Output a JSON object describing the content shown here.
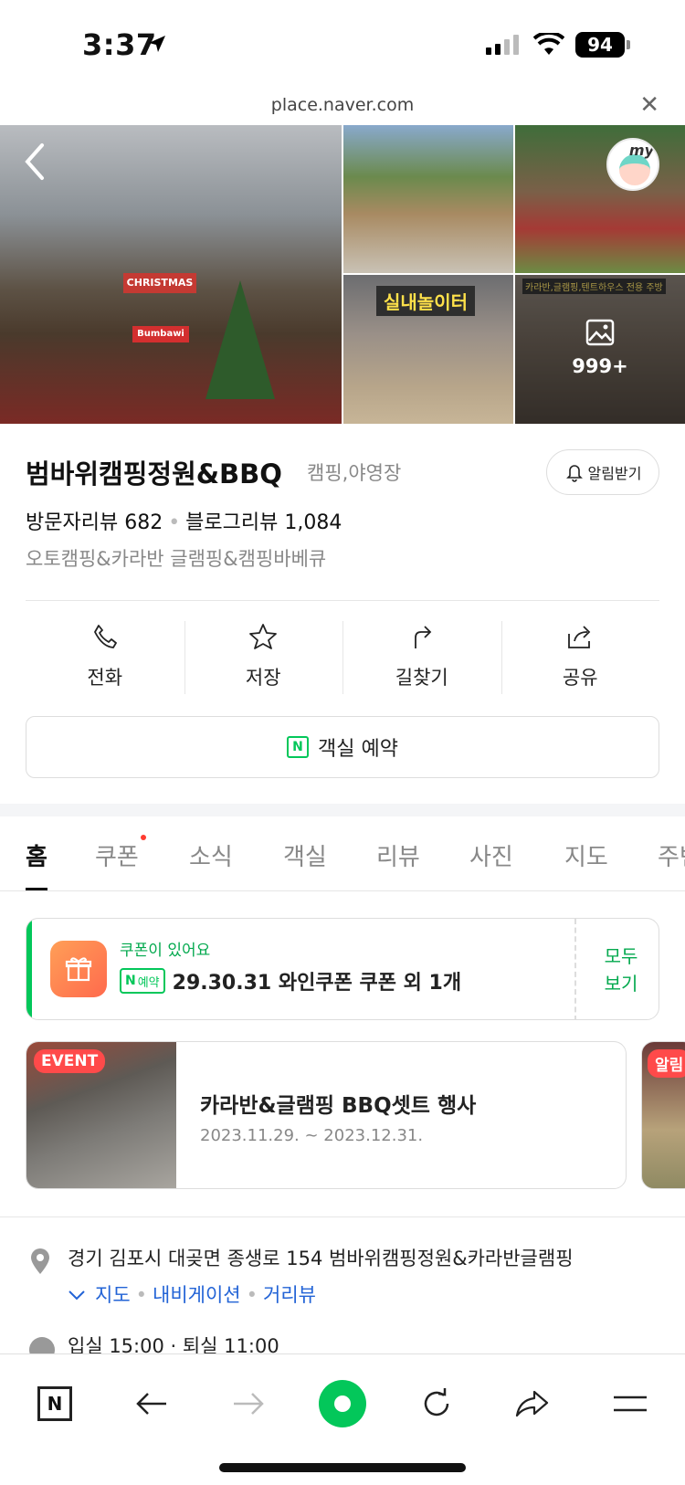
{
  "status_bar": {
    "time": "3:37",
    "battery": "94"
  },
  "browser": {
    "url": "place.naver.com"
  },
  "gallery": {
    "main_sign": "CHRISTMAS",
    "main_sign2": "Bumbawi",
    "indoor_label": "실내놀이터",
    "glamping_label": "카라반,글램핑,텐트하우스 전용 주방",
    "more_count": "999+",
    "avatar_text": "my"
  },
  "place": {
    "name": "범바위캠핑정원&BBQ",
    "category": "캠핑,야영장",
    "alarm_label": "알림받기",
    "visitor_reviews": "방문자리뷰 682",
    "blog_reviews": "블로그리뷰 1,084",
    "description": "오토캠핑&카라반 글램핑&캠핑바베큐"
  },
  "actions": [
    {
      "label": "전화",
      "icon": "phone-icon"
    },
    {
      "label": "저장",
      "icon": "star-icon"
    },
    {
      "label": "길찾기",
      "icon": "directions-icon"
    },
    {
      "label": "공유",
      "icon": "share-icon"
    }
  ],
  "reserve": {
    "label": "객실 예약"
  },
  "tabs": [
    "홈",
    "쿠폰",
    "소식",
    "객실",
    "리뷰",
    "사진",
    "지도",
    "주변"
  ],
  "coupon": {
    "title": "쿠폰이 있어요",
    "badge": "예약",
    "text": "29.30.31 와인쿠폰 쿠폰 외 1개",
    "all_label_1": "모두",
    "all_label_2": "보기"
  },
  "event": {
    "badge": "EVENT",
    "title": "카라반&글램핑 BBQ셋트 행사",
    "date": "2023.11.29. ~ 2023.12.31.",
    "next_badge": "알림"
  },
  "address": {
    "text": "경기 김포시 대곶면 종생로 154 범바위캠핑정원&카라반글램핑",
    "links": [
      "지도",
      "내비게이션",
      "거리뷰"
    ]
  },
  "hours": {
    "text": "입실 15:00 · 퇴실 11:00"
  },
  "colors": {
    "accent_green": "#03c75a",
    "link_blue": "#2263d6",
    "event_red": "#ff4a4a"
  }
}
